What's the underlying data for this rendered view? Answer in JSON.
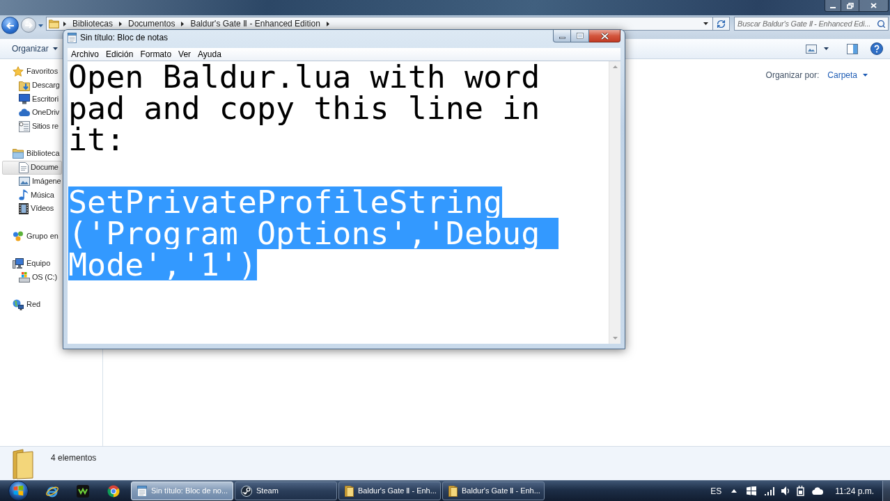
{
  "explorer": {
    "address_bar": {
      "crumbs": [
        "Bibliotecas",
        "Documentos",
        "Baldur's Gate Ⅱ - Enhanced Edition"
      ]
    },
    "search": {
      "placeholder": "Buscar Baldur's Gate Ⅱ - Enhanced Edi..."
    },
    "toolbar": {
      "organize": "Organizar"
    },
    "nav_pane": [
      {
        "label": "Favoritos",
        "kind": "favorites",
        "selected": false,
        "children": [
          {
            "label": "Descarg",
            "kind": "downloads",
            "selected": false
          },
          {
            "label": "Escritori",
            "kind": "desktop",
            "selected": false
          },
          {
            "label": "OneDriv",
            "kind": "cloud",
            "selected": false
          },
          {
            "label": "Sitios re",
            "kind": "recent",
            "selected": false
          }
        ]
      },
      {
        "label": "Biblioteca",
        "kind": "libraries",
        "selected": false,
        "children": [
          {
            "label": "Docume",
            "kind": "documents",
            "selected": true
          },
          {
            "label": "Imágene",
            "kind": "pictures",
            "selected": false
          },
          {
            "label": "Música",
            "kind": "music",
            "selected": false
          },
          {
            "label": "Vídeos",
            "kind": "videos",
            "selected": false
          }
        ]
      },
      {
        "label": "Grupo en",
        "kind": "homegroup",
        "selected": false
      },
      {
        "label": "Equipo",
        "kind": "computer",
        "selected": false,
        "children": [
          {
            "label": "OS (C:)",
            "kind": "drive",
            "selected": false
          }
        ]
      },
      {
        "label": "Red",
        "kind": "network",
        "selected": false
      }
    ],
    "arrange": {
      "label": "Organizar por:",
      "value": "Carpeta"
    },
    "status_bar": {
      "item_count": "4 elementos"
    }
  },
  "notepad": {
    "title": "Sin título: Bloc de notas",
    "menu": [
      "Archivo",
      "Edición",
      "Formato",
      "Ver",
      "Ayuda"
    ],
    "paragraphs": [
      {
        "selected": false,
        "lines": [
          "Open Baldur.lua with word",
          "pad and copy this line in",
          "it:"
        ]
      },
      {
        "selected": true,
        "lines": [
          "SetPrivateProfileString",
          "('Program Options','Debug ",
          "Mode','1')"
        ]
      }
    ]
  },
  "taskbar": {
    "tasks": [
      {
        "label": "Sin título: Bloc de no...",
        "kind": "notepad",
        "selected": true
      },
      {
        "label": "Steam",
        "kind": "steam",
        "selected": false
      },
      {
        "label": "Baldur's Gate Ⅱ - Enh...",
        "kind": "folder",
        "selected": false
      },
      {
        "label": "Baldur's Gate Ⅱ - Enh...",
        "kind": "folder",
        "selected": false
      }
    ],
    "language": "ES",
    "clock": "11:24 p.m."
  }
}
